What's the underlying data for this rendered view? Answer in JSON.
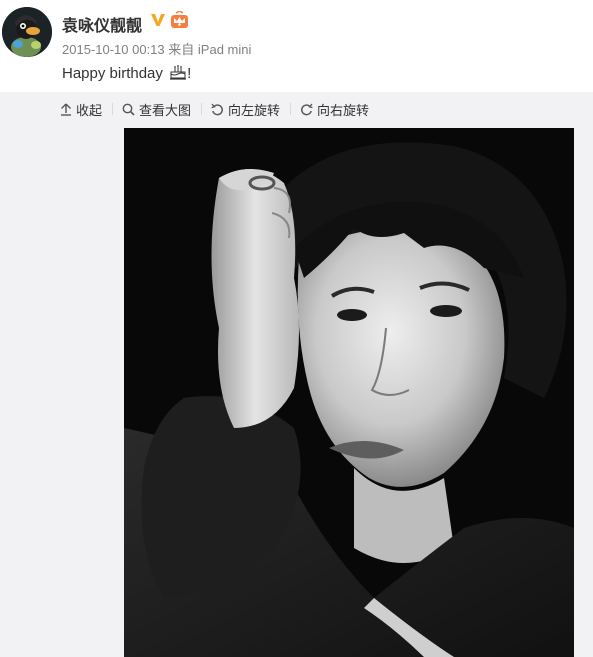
{
  "post": {
    "author": {
      "name": "袁咏仪靓靓",
      "avatar_icon": "avatar-image",
      "verified_icon": "verified-v-icon",
      "member_icon": "member-crown-icon",
      "verified_color": "#f5a623"
    },
    "meta": {
      "time": "2015-10-10 00:13",
      "from_label": "来自",
      "source": "iPad mini"
    },
    "text": {
      "body": "Happy birthday ",
      "emoji_icon": "birthday-cake-icon",
      "suffix": "!"
    }
  },
  "media": {
    "toolbar": {
      "collapse": "收起",
      "view_large": "查看大图",
      "rotate_left": "向左旋转",
      "rotate_right": "向右旋转"
    },
    "photo_icon": "portrait-photo",
    "background_color": "#f2f2f5"
  }
}
